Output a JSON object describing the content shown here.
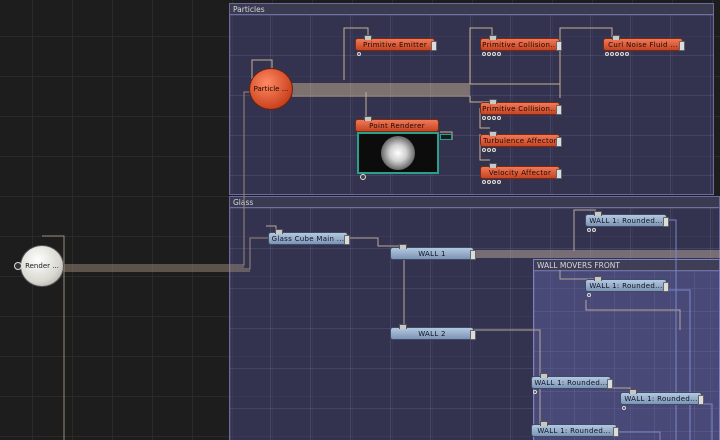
{
  "groups": {
    "particles": "Particles",
    "glass": "Glass",
    "wall_movers_front": "WALL MOVERS FRONT"
  },
  "nodes": {
    "render": "Render ...",
    "particle": "Particle ...",
    "primitive_emitter": "Primitive Emitter",
    "primitive_collision_1": "Primitive Collision...",
    "curl_noise_fluid": "Curl Noise Fluid ...",
    "point_renderer": "Point Renderer",
    "primitive_collision_2": "Primitive Collision...",
    "turbulence_affector": "Turbulence Affector",
    "velocity_affector": "Velocity Affector",
    "glass_cube_main": "Glass Cube Main ...",
    "wall_1": "WALL 1",
    "wall_2": "WALL 2",
    "wall1_rounded_a": "WALL 1: Rounded...",
    "wall1_rounded_b": "WALL 1: Rounded...",
    "wall1_rounded_c": "WALL 1: Rounded...",
    "wall1_rounded_d": "WALL 1: Rounded...",
    "wall1_rounded_e": "WALL 1: Rounded..."
  },
  "colors": {
    "particle_node": "#e0603c",
    "wall_node": "#9cb0cc",
    "group_bg": "#46467a",
    "preview_border": "#2aa08a"
  },
  "icons": [
    "output-jack-icon",
    "input-tab-icon",
    "port-dot-icon",
    "render-preview-sphere"
  ]
}
